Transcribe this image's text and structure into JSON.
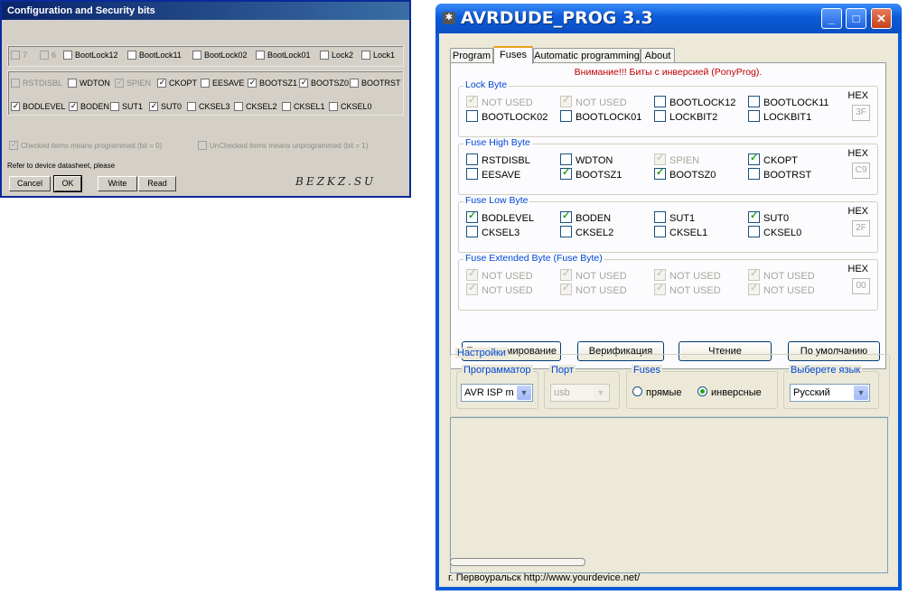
{
  "left_dialog": {
    "title": "Configuration and Security bits",
    "row1": [
      {
        "label": "7",
        "checked": false,
        "disabled": true
      },
      {
        "label": "6",
        "checked": false,
        "disabled": true
      },
      {
        "label": "BootLock12",
        "checked": false,
        "disabled": false
      },
      {
        "label": "BootLock11",
        "checked": false,
        "disabled": false
      },
      {
        "label": "BootLock02",
        "checked": false,
        "disabled": false
      },
      {
        "label": "BootLock01",
        "checked": false,
        "disabled": false
      },
      {
        "label": "Lock2",
        "checked": false,
        "disabled": false
      },
      {
        "label": "Lock1",
        "checked": false,
        "disabled": false
      }
    ],
    "row2": [
      {
        "label": "RSTDISBL",
        "checked": false,
        "disabled": true
      },
      {
        "label": "WDTON",
        "checked": false,
        "disabled": false
      },
      {
        "label": "SPIEN",
        "checked": true,
        "disabled": true
      },
      {
        "label": "CKOPT",
        "checked": true,
        "disabled": false
      },
      {
        "label": "EESAVE",
        "checked": false,
        "disabled": false
      },
      {
        "label": "BOOTSZ1",
        "checked": true,
        "disabled": false
      },
      {
        "label": "BOOTSZ0",
        "checked": true,
        "disabled": false
      },
      {
        "label": "BOOTRST",
        "checked": false,
        "disabled": false
      }
    ],
    "row3": [
      {
        "label": "BODLEVEL",
        "checked": true,
        "disabled": false
      },
      {
        "label": "BODEN",
        "checked": true,
        "disabled": false
      },
      {
        "label": "SUT1",
        "checked": false,
        "disabled": false
      },
      {
        "label": "SUT0",
        "checked": true,
        "disabled": false
      },
      {
        "label": "CKSEL3",
        "checked": false,
        "disabled": false
      },
      {
        "label": "CKSEL2",
        "checked": false,
        "disabled": false
      },
      {
        "label": "CKSEL1",
        "checked": false,
        "disabled": false
      },
      {
        "label": "CKSEL0",
        "checked": false,
        "disabled": false
      }
    ],
    "note_checked": "Checked items means programmed (bit = 0)",
    "note_unchecked": "UnChecked items means unprogrammed (bit = 1)",
    "refer": "Refer to device datasheet, please",
    "buttons": {
      "cancel": "Cancel",
      "ok": "OK",
      "write": "Write",
      "read": "Read"
    },
    "watermark": "BEZKZ.SU"
  },
  "window": {
    "title": "AVRDUDE_PROG 3.3",
    "tabs": [
      "Program",
      "Fuses",
      "Automatic programming",
      "About"
    ],
    "active_tab": "Fuses",
    "warning": "Внимание!!! Биты с инверсией (PonyProg).",
    "hex_label": "HEX",
    "groups": [
      {
        "caption": "Lock Byte",
        "hex": "3F",
        "bits": [
          {
            "label": "NOT USED",
            "checked": true,
            "disabled": true
          },
          {
            "label": "NOT USED",
            "checked": true,
            "disabled": true
          },
          {
            "label": "BOOTLOCK12",
            "checked": false,
            "disabled": false
          },
          {
            "label": "BOOTLOCK11",
            "checked": false,
            "disabled": false
          },
          {
            "label": "BOOTLOCK02",
            "checked": false,
            "disabled": false
          },
          {
            "label": "BOOTLOCK01",
            "checked": false,
            "disabled": false
          },
          {
            "label": "LOCKBIT2",
            "checked": false,
            "disabled": false
          },
          {
            "label": "LOCKBIT1",
            "checked": false,
            "disabled": false
          }
        ]
      },
      {
        "caption": "Fuse High Byte",
        "hex": "C9",
        "bits": [
          {
            "label": "RSTDISBL",
            "checked": false,
            "disabled": false
          },
          {
            "label": "WDTON",
            "checked": false,
            "disabled": false
          },
          {
            "label": "SPIEN",
            "checked": true,
            "disabled": true
          },
          {
            "label": "CKOPT",
            "checked": true,
            "disabled": false
          },
          {
            "label": "EESAVE",
            "checked": false,
            "disabled": false
          },
          {
            "label": "BOOTSZ1",
            "checked": true,
            "disabled": false
          },
          {
            "label": "BOOTSZ0",
            "checked": true,
            "disabled": false
          },
          {
            "label": "BOOTRST",
            "checked": false,
            "disabled": false
          }
        ]
      },
      {
        "caption": "Fuse Low Byte",
        "hex": "2F",
        "bits": [
          {
            "label": "BODLEVEL",
            "checked": true,
            "disabled": false
          },
          {
            "label": "BODEN",
            "checked": true,
            "disabled": false
          },
          {
            "label": "SUT1",
            "checked": false,
            "disabled": false
          },
          {
            "label": "SUT0",
            "checked": true,
            "disabled": false
          },
          {
            "label": "CKSEL3",
            "checked": false,
            "disabled": false
          },
          {
            "label": "CKSEL2",
            "checked": false,
            "disabled": false
          },
          {
            "label": "CKSEL1",
            "checked": false,
            "disabled": false
          },
          {
            "label": "CKSEL0",
            "checked": false,
            "disabled": false
          }
        ]
      },
      {
        "caption": "Fuse Extended Byte (Fuse Byte)",
        "hex": "00",
        "bits": [
          {
            "label": "NOT USED",
            "checked": true,
            "disabled": true
          },
          {
            "label": "NOT USED",
            "checked": true,
            "disabled": true
          },
          {
            "label": "NOT USED",
            "checked": true,
            "disabled": true
          },
          {
            "label": "NOT USED",
            "checked": true,
            "disabled": true
          },
          {
            "label": "NOT USED",
            "checked": true,
            "disabled": true
          },
          {
            "label": "NOT USED",
            "checked": true,
            "disabled": true
          },
          {
            "label": "NOT USED",
            "checked": true,
            "disabled": true
          },
          {
            "label": "NOT USED",
            "checked": true,
            "disabled": true
          }
        ]
      }
    ],
    "actions": {
      "program": "Программирование",
      "verify": "Верификация",
      "read": "Чтение",
      "default": "По умолчанию"
    },
    "settings": {
      "caption": "Настройки",
      "programmer_caption": "Программатор",
      "programmer_value": "AVR ISP m",
      "port_caption": "Порт",
      "port_value": "usb",
      "fuses_caption": "Fuses",
      "fuses_direct": "прямые",
      "fuses_inverse": "инверсные",
      "fuses_selected": "инверсные",
      "lang_caption": "Выберете язык",
      "lang_value": "Русский"
    },
    "status": "г. Первоуральск   http://www.yourdevice.net/",
    "colors": {
      "title_bar": "#0b5bd8",
      "caption": "#0046d5",
      "warning": "#c00000",
      "check": "#21a121"
    }
  }
}
